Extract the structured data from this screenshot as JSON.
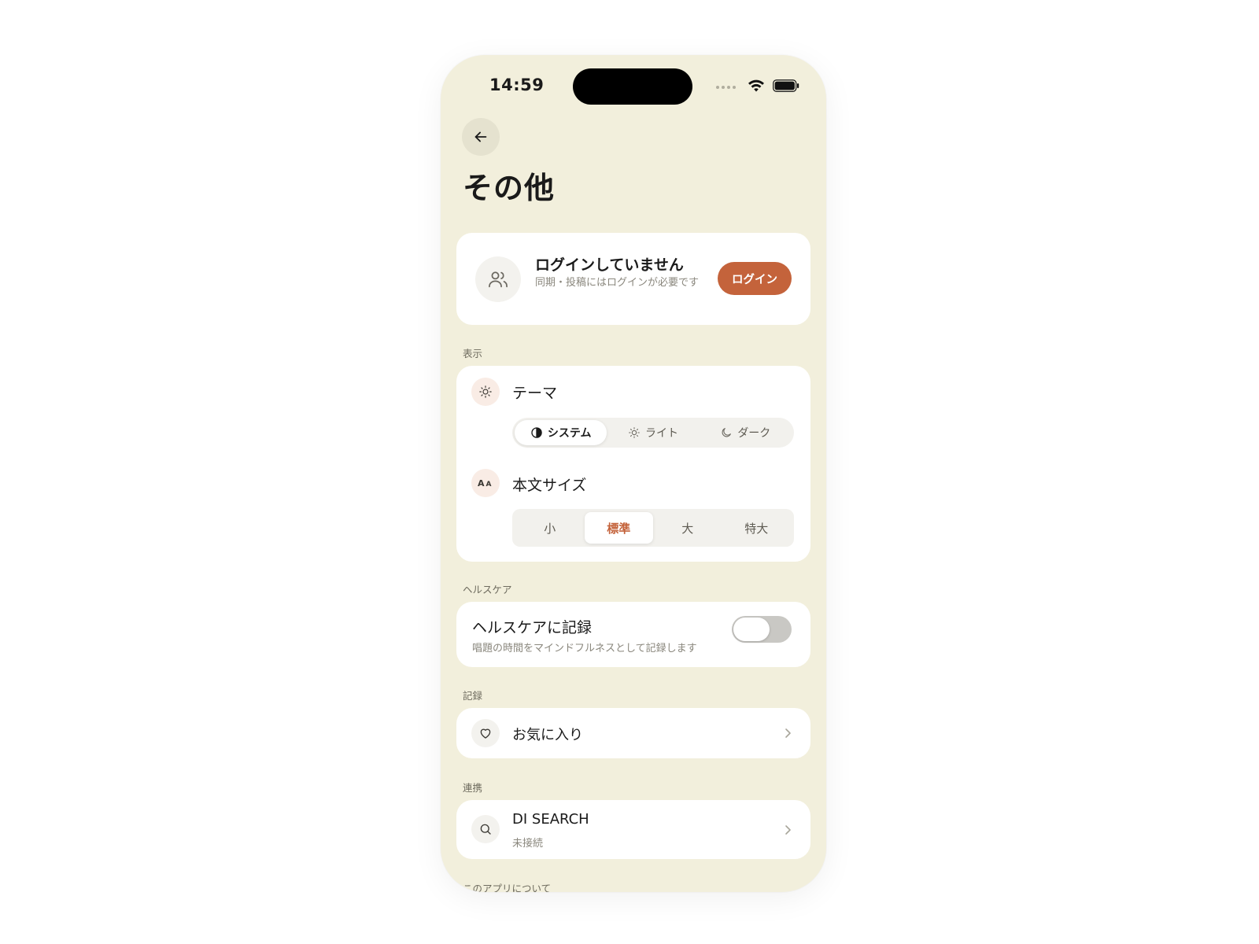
{
  "status_bar": {
    "time": "14:59"
  },
  "header": {
    "title": "その他"
  },
  "account": {
    "title": "ログインしていません",
    "subtitle": "同期・投稿にはログインが必要です",
    "login_label": "ログイン"
  },
  "display": {
    "section_label": "表示",
    "theme": {
      "label": "テーマ",
      "options": [
        "システム",
        "ライト",
        "ダーク"
      ],
      "selected": "システム"
    },
    "font_size": {
      "label": "本文サイズ",
      "options": [
        "小",
        "標準",
        "大",
        "特大"
      ],
      "selected": "標準"
    }
  },
  "healthcare": {
    "section_label": "ヘルスケア",
    "title": "ヘルスケアに記録",
    "subtitle": "唱題の時間をマインドフルネスとして記録します",
    "enabled": false
  },
  "records": {
    "section_label": "記録",
    "favorites_label": "お気に入り"
  },
  "integrations": {
    "section_label": "連携",
    "di_search_label": "DI SEARCH",
    "di_search_status": "未接続"
  },
  "about": {
    "section_label": "このアプリについて"
  },
  "colors": {
    "accent": "#c4633b",
    "background": "#f2efdc",
    "card": "#ffffff"
  }
}
